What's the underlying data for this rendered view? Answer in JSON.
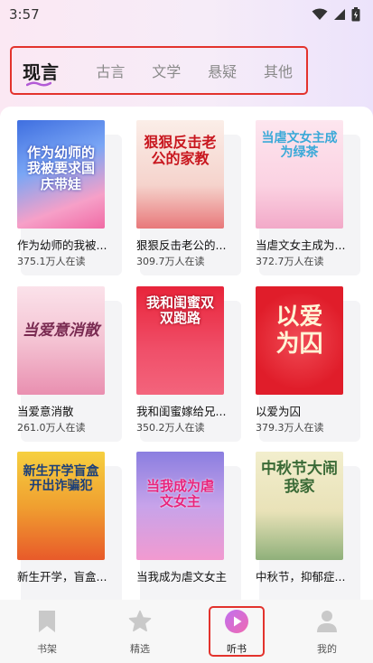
{
  "status": {
    "time": "3:57"
  },
  "tabs": [
    {
      "label": "现言",
      "active": true
    },
    {
      "label": "古言",
      "active": false
    },
    {
      "label": "文学",
      "active": false
    },
    {
      "label": "悬疑",
      "active": false
    },
    {
      "label": "其他",
      "active": false
    }
  ],
  "books": [
    {
      "title": "作为幼师的我被...",
      "count": "375.1万人在读",
      "cover_text": "作为幼师的我被要求国庆带娃",
      "palette": [
        "#4a7be0",
        "#f06aa4"
      ]
    },
    {
      "title": "狠狠反击老公的...",
      "count": "309.7万人在读",
      "cover_text": "狠狠反击老公的家教",
      "palette": [
        "#f7e6e0",
        "#e8787a"
      ]
    },
    {
      "title": "当虐文女主成为...",
      "count": "372.7万人在读",
      "cover_text": "当虐文女主成为绿茶",
      "palette": [
        "#fbdbe8",
        "#f2a9c8"
      ]
    },
    {
      "title": "当爱意消散",
      "count": "261.0万人在读",
      "cover_text": "当爱意消散",
      "palette": [
        "#f7d0dc",
        "#e98fb0"
      ]
    },
    {
      "title": "我和闺蜜嫁给兄...",
      "count": "350.2万人在读",
      "cover_text": "我和闺蜜双双跑路",
      "palette": [
        "#e8243a",
        "#f3647c"
      ]
    },
    {
      "title": "以爱为囚",
      "count": "379.3万人在读",
      "cover_text": "以爱为囚",
      "palette": [
        "#e01d2a",
        "#f04b55"
      ]
    },
    {
      "title": "新生开学，盲盒...",
      "count": "",
      "cover_text": "新生开学盲盒开出诈骗犯",
      "palette": [
        "#f0c020",
        "#e85a2a"
      ]
    },
    {
      "title": "当我成为虐文女主",
      "count": "",
      "cover_text": "当我成为虐文女主",
      "palette": [
        "#8a7ee0",
        "#f29ad0"
      ]
    },
    {
      "title": "中秋节，抑郁症...",
      "count": "",
      "cover_text": "中秋节大闹我家",
      "palette": [
        "#e9e2b8",
        "#6f9a62"
      ]
    }
  ],
  "nav": [
    {
      "label": "书架",
      "icon": "bookmark-icon",
      "active": false
    },
    {
      "label": "精选",
      "icon": "star-icon",
      "active": false
    },
    {
      "label": "听书",
      "icon": "play-icon",
      "active": true
    },
    {
      "label": "我的",
      "icon": "user-icon",
      "active": false
    }
  ],
  "colors": {
    "accent": "#f06ab0",
    "highlight_box": "#e3332d",
    "inactive_icon": "#c9c9c9"
  }
}
